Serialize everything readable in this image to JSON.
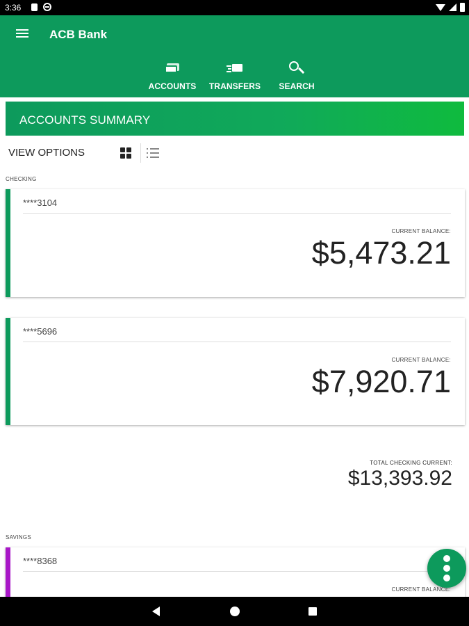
{
  "status_bar": {
    "time": "3:36"
  },
  "app_bar": {
    "title": "ACB Bank",
    "tabs": [
      {
        "label": "ACCOUNTS",
        "icon": "accounts-icon"
      },
      {
        "label": "TRANSFERS",
        "icon": "transfers-icon"
      },
      {
        "label": "SEARCH",
        "icon": "search-icon"
      }
    ],
    "color": "#0d9a5c"
  },
  "summary": {
    "title": "ACCOUNTS SUMMARY"
  },
  "view_options": {
    "label": "VIEW OPTIONS"
  },
  "checking": {
    "section_label": "CHECKING",
    "accent_color": "#0d9a5c",
    "accounts": [
      {
        "number": "****3104",
        "balance_label": "CURRENT BALANCE:",
        "balance": "$5,473.21"
      },
      {
        "number": "****5696",
        "balance_label": "CURRENT BALANCE:",
        "balance": "$7,920.71"
      }
    ],
    "total_label": "TOTAL CHECKING CURRENT:",
    "total": "$13,393.92"
  },
  "savings": {
    "section_label": "SAVINGS",
    "accent_color": "#a817c7",
    "accounts": [
      {
        "number": "****8368",
        "balance_label": "CURRENT BALANCE:"
      }
    ]
  }
}
